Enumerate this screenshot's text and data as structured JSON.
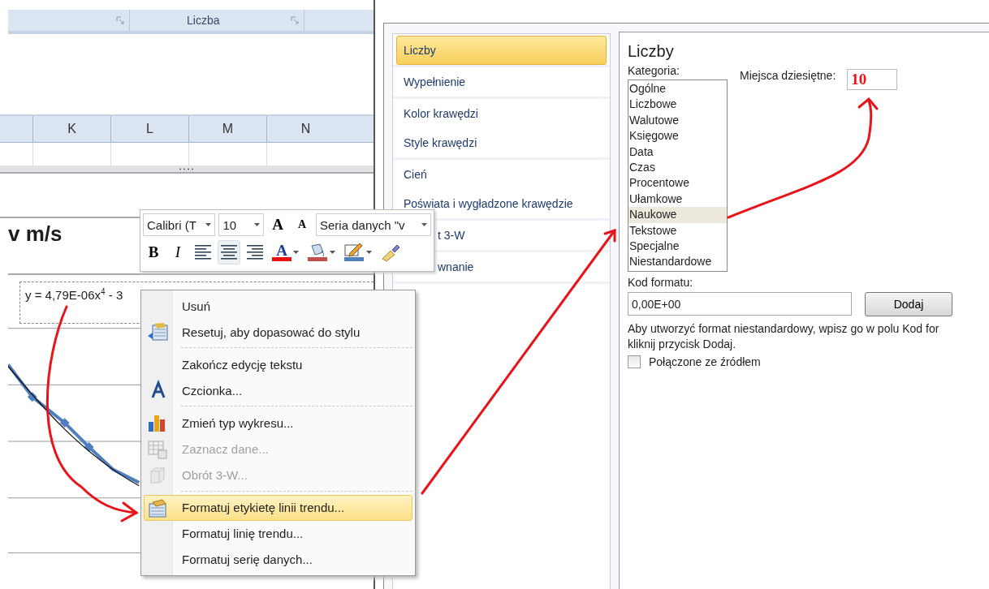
{
  "ribbon": {
    "group_label": "Liczba"
  },
  "sheet": {
    "columns": [
      "K",
      "L",
      "M",
      "N"
    ]
  },
  "chart": {
    "title": "v m/s",
    "trendline_label": "y = 4,79E-06x$^{4}$ - 3"
  },
  "mini_toolbar": {
    "font": "Calibri (T",
    "size": "10",
    "grow_font": "A",
    "shrink_font": "A",
    "element": "Seria danych \"v",
    "buttons": [
      {
        "kind": "bold",
        "label": "B",
        "selected": false
      },
      {
        "kind": "italic",
        "label": "I",
        "selected": false
      },
      {
        "kind": "align-left",
        "selected": false
      },
      {
        "kind": "align-center",
        "selected": true
      },
      {
        "kind": "align-right",
        "selected": false
      },
      {
        "kind": "font-color",
        "label": "A"
      },
      {
        "kind": "fill-color"
      },
      {
        "kind": "border-color"
      },
      {
        "kind": "painter"
      }
    ]
  },
  "context_menu": {
    "groups": [
      [
        {
          "kind": "plain",
          "label": "Usuń",
          "disabled": false,
          "selected": false
        },
        {
          "kind": "reset",
          "label": "Resetuj, aby dopasować do stylu",
          "disabled": false,
          "selected": false
        }
      ],
      [
        {
          "kind": "plain",
          "label": "Zakończ edycję tekstu",
          "disabled": false,
          "selected": false
        },
        {
          "kind": "font",
          "label": "Czcionka...",
          "disabled": false,
          "selected": false
        }
      ],
      [
        {
          "kind": "chart-type",
          "label": "Zmień typ wykresu...",
          "disabled": false,
          "selected": false
        },
        {
          "kind": "select-data",
          "label": "Zaznacz dane...",
          "disabled": true,
          "selected": false
        },
        {
          "kind": "rotation",
          "label": "Obrót 3-W...",
          "disabled": true,
          "selected": false
        }
      ],
      [
        {
          "kind": "format",
          "label": "Formatuj etykietę linii trendu...",
          "disabled": false,
          "selected": true
        },
        {
          "kind": "plain",
          "label": "Formatuj linię trendu...",
          "disabled": false,
          "selected": false
        },
        {
          "kind": "plain",
          "label": "Formatuj serię danych...",
          "disabled": false,
          "selected": false
        }
      ]
    ]
  },
  "dialog": {
    "nav_groups": [
      [
        {
          "label": "Liczby",
          "selected": true
        }
      ],
      [
        {
          "label": "Wypełnienie",
          "selected": false
        }
      ],
      [
        {
          "label": "Kolor krawędzi",
          "selected": false
        },
        {
          "label": "Style krawędzi",
          "selected": false
        }
      ],
      [
        {
          "label": "Cień",
          "selected": false
        },
        {
          "label": "Poświata i wygładzone krawędzie",
          "selected": false
        }
      ],
      [
        {
          "label": "t 3-W",
          "selected": false
        }
      ],
      [
        {
          "label": "wnanie",
          "selected": false
        }
      ]
    ],
    "panel": {
      "title": "Liczby",
      "category_label": "Kategoria:",
      "categories": [
        {
          "label": "Ogólne",
          "selected": false
        },
        {
          "label": "Liczbowe",
          "selected": false
        },
        {
          "label": "Walutowe",
          "selected": false
        },
        {
          "label": "Księgowe",
          "selected": false
        },
        {
          "label": "Data",
          "selected": false
        },
        {
          "label": "Czas",
          "selected": false
        },
        {
          "label": "Procentowe",
          "selected": false
        },
        {
          "label": "Ułamkowe",
          "selected": false
        },
        {
          "label": "Naukowe",
          "selected": true
        },
        {
          "label": "Tekstowe",
          "selected": false
        },
        {
          "label": "Specjalne",
          "selected": false
        },
        {
          "label": "Niestandardowe",
          "selected": false
        }
      ],
      "decimals_label": "Miejsca dziesiętne:",
      "decimals_value": "10",
      "format_code_label": "Kod formatu:",
      "format_code": "0,00E+00",
      "add_button": "Dodaj",
      "hint_lines": [
        "Aby utworzyć format niestandardowy, wpisz go w polu Kod for",
        "kliknij przycisk Dodaj."
      ],
      "linked_checkbox": {
        "label": "Połączone ze źródłem",
        "checked": false
      }
    }
  }
}
